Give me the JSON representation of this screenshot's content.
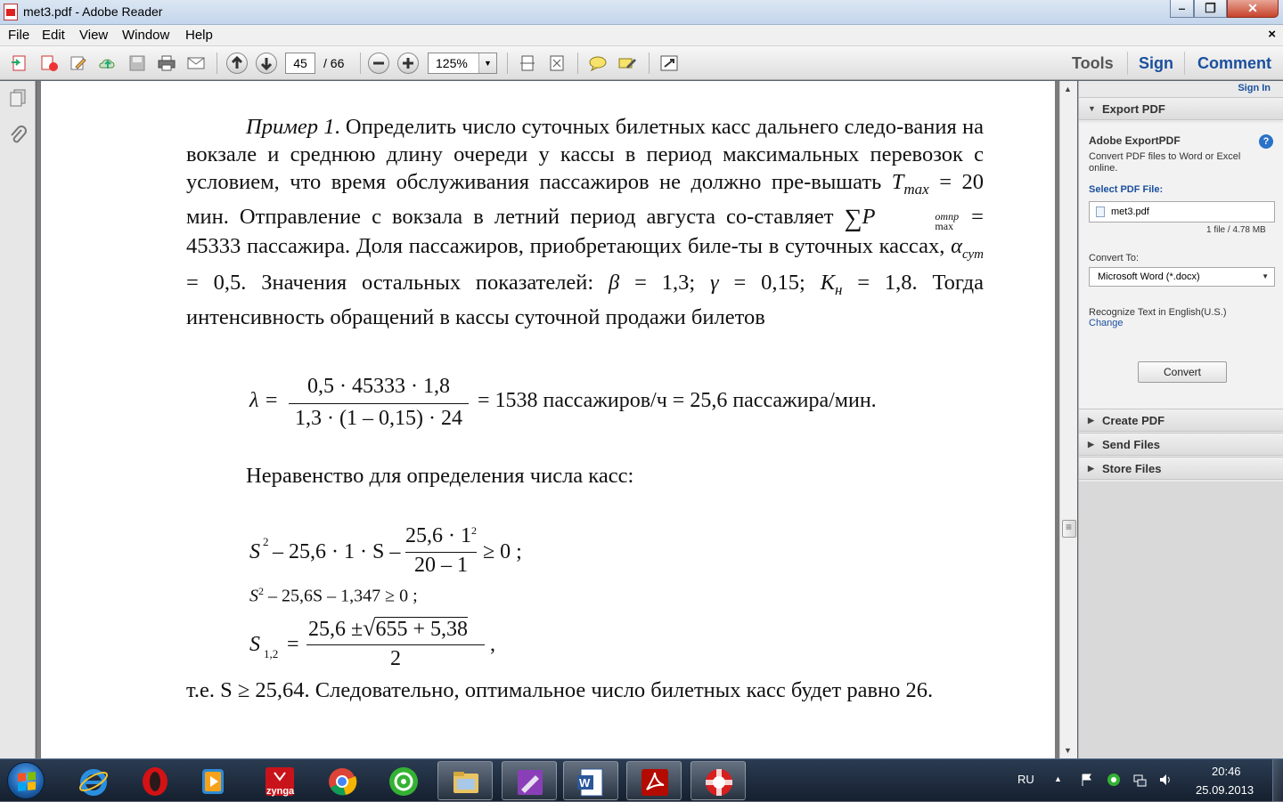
{
  "window": {
    "title": "met3.pdf - Adobe Reader",
    "controls": {
      "minimize": "–",
      "maximize": "❐",
      "close": "✕"
    }
  },
  "menu": [
    "File",
    "Edit",
    "View",
    "Window",
    "Help"
  ],
  "menu_close": "×",
  "toolbar": {
    "page_current": "45",
    "page_total": "/ 66",
    "zoom": "125%",
    "zoom_dropdown": "▼",
    "tabs": [
      "Tools",
      "Sign",
      "Comment"
    ],
    "icons": [
      "create-pdf-icon",
      "combine-icon",
      "edit-icon",
      "upload-icon",
      "save-icon",
      "print-icon",
      "email-icon",
      "prev-page-icon",
      "next-page-icon",
      "zoom-out-icon",
      "zoom-in-icon",
      "fit-page-icon",
      "fit-width-icon",
      "comment-icon",
      "highlight-icon",
      "full-screen-icon"
    ]
  },
  "document": {
    "para1": {
      "lead": "Пример 1",
      "text1": ". Определить число суточных билетных касс дальнего следо-вания на вокзале и среднюю длину очереди у кассы в период максимальных перевозок с условием, что время обслуживания пассажиров не должно пре-вышать ",
      "t": "T",
      "t_sub": "max",
      "text2": " = 20 мин. Отправление с вокзала в летний период августа со-ставляет ",
      "sum": "∑",
      "p": "P",
      "p_sup": "отпр",
      "p_sub": "max",
      "text3": " = 45333 пассажира. Доля пассажиров, приобретающих биле-ты в суточных кассах, ",
      "alpha": "α",
      "alpha_sub": "сут",
      "text4": " = 0,5. Значения остальных показателей: ",
      "beta": "β",
      "text5": " = 1,3; ",
      "gamma": "γ",
      "text6": " = 0,15; ",
      "k": "К",
      "k_sub": "н",
      "text7": " = 1,8. Тогда интенсивность обращений в кассы суточной продажи билетов"
    },
    "formula1": {
      "lambda": "λ =",
      "num": "0,5 · 45333 · 1,8",
      "den": "1,3 · (1 – 0,15) · 24",
      "rest": "= 1538 пассажиров/ч = 25,6 пассажира/мин."
    },
    "ineq_label": "Неравенство для определения числа касс:",
    "formula2": {
      "left": "S",
      "sup": "2",
      "mid": " – 25,6 · 1 · S –",
      "num": "25,6 · 1",
      "num_sup": "2",
      "den": "20 – 1",
      "right": "≥ 0 ;"
    },
    "formula3": {
      "left": "S",
      "sup": "2",
      "rest": " – 25,6S – 1,347 ≥ 0 ;"
    },
    "formula4": {
      "left": "S",
      "sub": "1,2",
      "eq": "=",
      "num_a": "25,6 ±",
      "sqrt": "√",
      "num_b": "655 + 5,38",
      "den": "2",
      "comma": ","
    },
    "conclusion": "т.е. S ≥ 25,64. Следовательно, оптимальное число билетных касс будет равно 26."
  },
  "right_pane": {
    "sign_in": "Sign In",
    "export_head": "Export PDF",
    "export_title": "Adobe ExportPDF",
    "export_desc": "Convert PDF files to Word or Excel online.",
    "select_label": "Select PDF File:",
    "file_name": "met3.pdf",
    "file_info": "1 file / 4.78 MB",
    "convert_to_label": "Convert To:",
    "convert_to_value": "Microsoft Word (*.docx)",
    "recognize": "Recognize Text in English(U.S.)",
    "change": "Change",
    "convert_button": "Convert",
    "sections": [
      "Create PDF",
      "Send Files",
      "Store Files"
    ]
  },
  "taskbar": {
    "apps": [
      {
        "name": "internet-explorer",
        "open": false
      },
      {
        "name": "opera",
        "open": false
      },
      {
        "name": "media-player",
        "open": false
      },
      {
        "name": "zynga",
        "label": "zynga",
        "open": false
      },
      {
        "name": "chrome",
        "open": false
      },
      {
        "name": "mail-agent",
        "open": false
      },
      {
        "name": "file-explorer",
        "open": true
      },
      {
        "name": "onenote",
        "open": true
      },
      {
        "name": "word",
        "open": true
      },
      {
        "name": "adobe-reader",
        "open": true
      },
      {
        "name": "lifebuoy-app",
        "open": true
      }
    ],
    "language": "RU",
    "tray_arrow": "▲",
    "time": "20:46",
    "date": "25.09.2013"
  },
  "colors": {
    "accent_link": "#1a4f9e",
    "taskbar": "#1c2a3c",
    "close_button": "#c7432b"
  }
}
